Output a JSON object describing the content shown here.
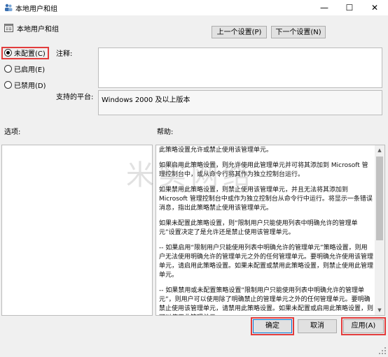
{
  "window": {
    "title": "本地用户和组",
    "controls": {
      "minimize": "—",
      "maximize": "☐",
      "close": "✕"
    }
  },
  "header": {
    "setting_name": "本地用户和组",
    "prev_label": "上一个设置(P)",
    "next_label": "下一个设置(N)"
  },
  "options": {
    "radios": [
      {
        "label": "未配置(C)",
        "selected": true
      },
      {
        "label": "已启用(E)",
        "selected": false
      },
      {
        "label": "已禁用(D)",
        "selected": false
      }
    ]
  },
  "comment": {
    "label": "注释:",
    "value": ""
  },
  "platform": {
    "label": "支持的平台:",
    "value": "Windows 2000 及以上版本"
  },
  "panes": {
    "options_label": "选项:",
    "help_label": "帮助:"
  },
  "help": {
    "paragraphs": [
      "此策略设置允许或禁止使用该管理单元。",
      "如果启用此策略设置，则允许使用此管理单元并可将其添加到 Microsoft 管理控制台中，或从命令行将其作为独立控制台运行。",
      "如果禁用此策略设置，则禁止使用该管理单元，并且无法将其添加到 Microsoft 管理控制台中或作为独立控制台从命令行中运行。将显示一条错误消息，指出此策略禁止使用该管理单元。",
      "如果未配置此策略设置，则“限制用户只能使用列表中明确允许的管理单元”设置决定了是允许还是禁止使用该管理单元。",
      "-- 如果启用“限制用户只能使用列表中明确允许的管理单元”策略设置，则用户无法使用明确允许的管理单元之外的任何管理单元。要明确允许使用该管理单元，请启用此策略设置。如果未配置或禁用此策略设置，则禁止使用此管理单元。",
      "-- 如果禁用或未配置策略设置“限制用户只能使用列表中明确允许的管理单元”，则用户可以使用除了明确禁止的管理单元之外的任何管理单元。要明确禁止使用该管理单元，请禁用此策略设置。如果未配置或启用此策略设置，则可以使用此管理单元。"
    ]
  },
  "watermark": "米实网络",
  "buttons": {
    "ok": "确定",
    "cancel": "取消",
    "apply": "应用(A)"
  },
  "colors": {
    "highlight": "#e23c3c",
    "accent": "#0078d7"
  }
}
